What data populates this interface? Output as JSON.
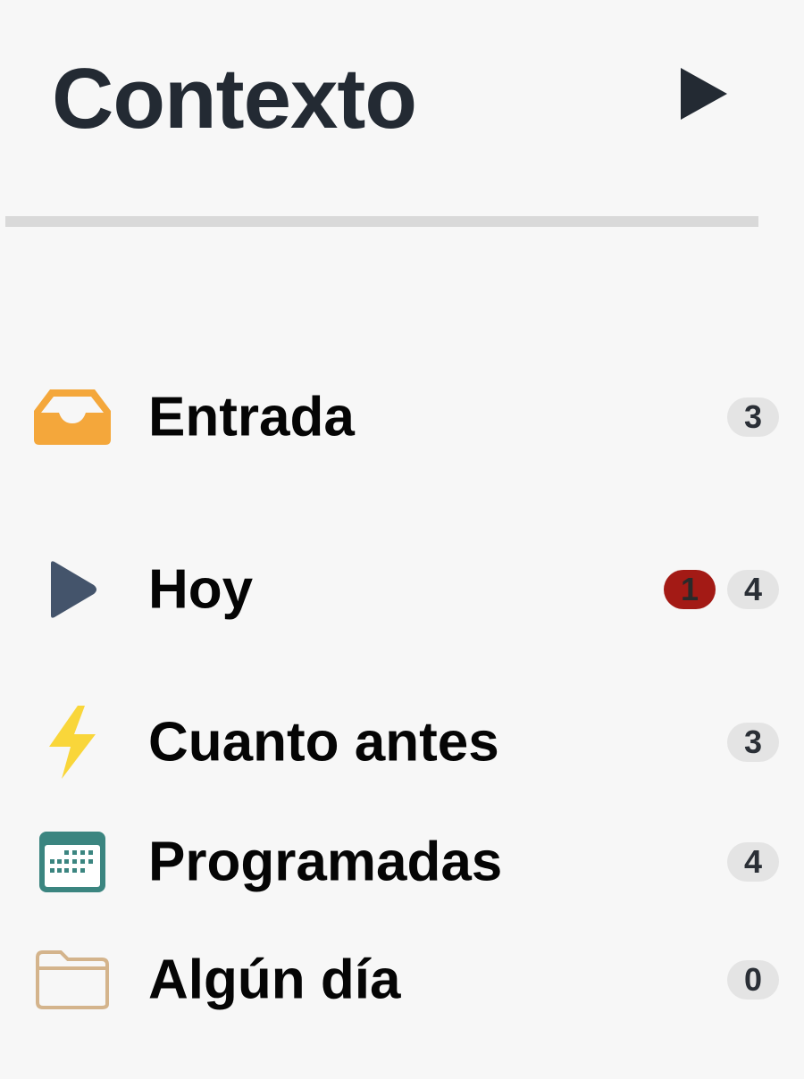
{
  "header": {
    "title": "Contexto",
    "toggle_icon": "play-triangle-icon"
  },
  "colors": {
    "title": "#232a33",
    "inbox": "#f4a73b",
    "today": "#44546b",
    "asap": "#f9d63a",
    "scheduled": "#3b8580",
    "someday": "#d4b48c",
    "overdue_badge": "#a31a15",
    "count_badge": "#e4e4e4"
  },
  "nav": {
    "items": [
      {
        "label": "Entrada",
        "icon": "inbox-tray-icon",
        "count": "3"
      },
      {
        "label": "Hoy",
        "icon": "today-triangle-icon",
        "overdue": "1",
        "count": "4"
      },
      {
        "label": "Cuanto antes",
        "icon": "lightning-bolt-icon",
        "count": "3"
      },
      {
        "label": "Programadas",
        "icon": "calendar-icon",
        "count": "4"
      },
      {
        "label": "Algún día",
        "icon": "folder-icon",
        "count": "0"
      }
    ]
  }
}
